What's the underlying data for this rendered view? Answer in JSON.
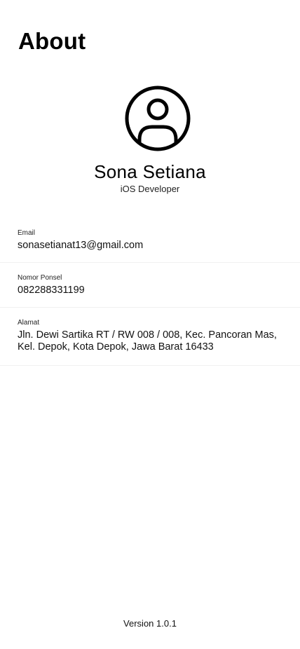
{
  "page": {
    "title": "About"
  },
  "profile": {
    "avatar_icon": "person-circle-icon",
    "name": "Sona Setiana",
    "role": "iOS Developer"
  },
  "info": {
    "email": {
      "label": "Email",
      "value": "sonasetianat13@gmail.com"
    },
    "phone": {
      "label": "Nomor Ponsel",
      "value": "082288331199"
    },
    "address": {
      "label": "Alamat",
      "value": "Jln. Dewi Sartika RT / RW 008 / 008, Kec. Pancoran Mas, Kel. Depok, Kota Depok, Jawa Barat 16433"
    }
  },
  "footer": {
    "version": "Version 1.0.1"
  }
}
